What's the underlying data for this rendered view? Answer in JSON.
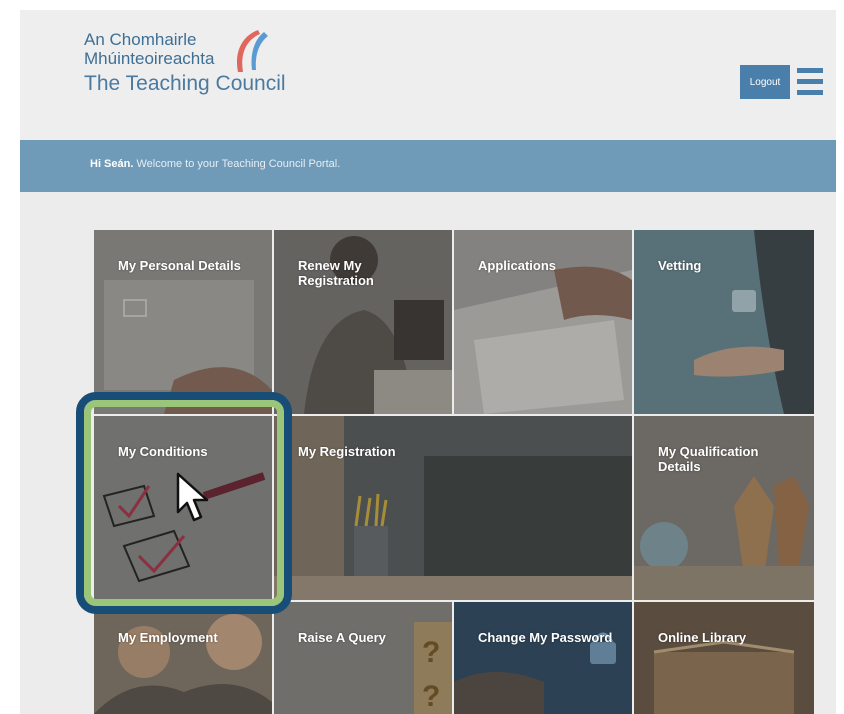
{
  "logo": {
    "line1": "An Chomhairle",
    "line2": "Mhúinteoireachta",
    "line3": "The Teaching Council"
  },
  "header": {
    "logout_label": "Logout",
    "menu_icon": "hamburger-menu-icon"
  },
  "welcome": {
    "name": "Hi Seán.",
    "message": " Welcome to your Teaching Council Portal."
  },
  "tiles": [
    {
      "label": "My Personal Details"
    },
    {
      "label": "Renew My Registration"
    },
    {
      "label": "Applications"
    },
    {
      "label": "Vetting"
    },
    {
      "label": "My Conditions"
    },
    {
      "label": "My Registration"
    },
    {
      "label": "My Qualification Details"
    },
    {
      "label": "My Employment"
    },
    {
      "label": "Raise A Query"
    },
    {
      "label": "Change My Password"
    },
    {
      "label": "Online Library"
    }
  ],
  "colors": {
    "brand_blue": "#4a7fac",
    "welcome_bar": "#6f9bb9",
    "highlight_outer": "#174d77",
    "highlight_inner": "#9bc67a"
  }
}
